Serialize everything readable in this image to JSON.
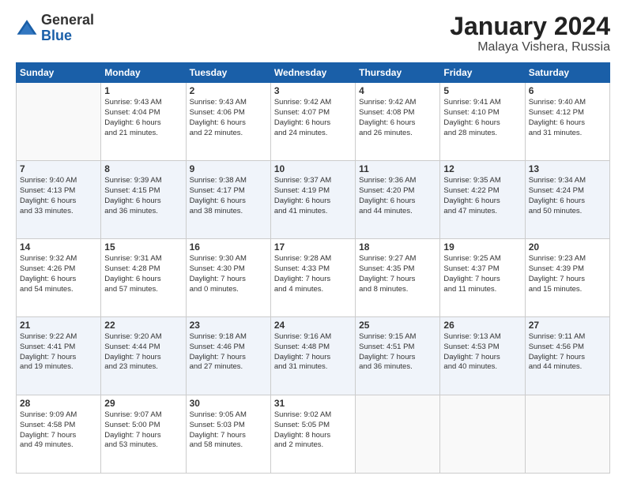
{
  "header": {
    "logo_general": "General",
    "logo_blue": "Blue",
    "title": "January 2024",
    "subtitle": "Malaya Vishera, Russia"
  },
  "calendar": {
    "headers": [
      "Sunday",
      "Monday",
      "Tuesday",
      "Wednesday",
      "Thursday",
      "Friday",
      "Saturday"
    ],
    "rows": [
      [
        {
          "day": "",
          "detail": ""
        },
        {
          "day": "1",
          "detail": "Sunrise: 9:43 AM\nSunset: 4:04 PM\nDaylight: 6 hours\nand 21 minutes."
        },
        {
          "day": "2",
          "detail": "Sunrise: 9:43 AM\nSunset: 4:06 PM\nDaylight: 6 hours\nand 22 minutes."
        },
        {
          "day": "3",
          "detail": "Sunrise: 9:42 AM\nSunset: 4:07 PM\nDaylight: 6 hours\nand 24 minutes."
        },
        {
          "day": "4",
          "detail": "Sunrise: 9:42 AM\nSunset: 4:08 PM\nDaylight: 6 hours\nand 26 minutes."
        },
        {
          "day": "5",
          "detail": "Sunrise: 9:41 AM\nSunset: 4:10 PM\nDaylight: 6 hours\nand 28 minutes."
        },
        {
          "day": "6",
          "detail": "Sunrise: 9:40 AM\nSunset: 4:12 PM\nDaylight: 6 hours\nand 31 minutes."
        }
      ],
      [
        {
          "day": "7",
          "detail": "Sunrise: 9:40 AM\nSunset: 4:13 PM\nDaylight: 6 hours\nand 33 minutes."
        },
        {
          "day": "8",
          "detail": "Sunrise: 9:39 AM\nSunset: 4:15 PM\nDaylight: 6 hours\nand 36 minutes."
        },
        {
          "day": "9",
          "detail": "Sunrise: 9:38 AM\nSunset: 4:17 PM\nDaylight: 6 hours\nand 38 minutes."
        },
        {
          "day": "10",
          "detail": "Sunrise: 9:37 AM\nSunset: 4:19 PM\nDaylight: 6 hours\nand 41 minutes."
        },
        {
          "day": "11",
          "detail": "Sunrise: 9:36 AM\nSunset: 4:20 PM\nDaylight: 6 hours\nand 44 minutes."
        },
        {
          "day": "12",
          "detail": "Sunrise: 9:35 AM\nSunset: 4:22 PM\nDaylight: 6 hours\nand 47 minutes."
        },
        {
          "day": "13",
          "detail": "Sunrise: 9:34 AM\nSunset: 4:24 PM\nDaylight: 6 hours\nand 50 minutes."
        }
      ],
      [
        {
          "day": "14",
          "detail": "Sunrise: 9:32 AM\nSunset: 4:26 PM\nDaylight: 6 hours\nand 54 minutes."
        },
        {
          "day": "15",
          "detail": "Sunrise: 9:31 AM\nSunset: 4:28 PM\nDaylight: 6 hours\nand 57 minutes."
        },
        {
          "day": "16",
          "detail": "Sunrise: 9:30 AM\nSunset: 4:30 PM\nDaylight: 7 hours\nand 0 minutes."
        },
        {
          "day": "17",
          "detail": "Sunrise: 9:28 AM\nSunset: 4:33 PM\nDaylight: 7 hours\nand 4 minutes."
        },
        {
          "day": "18",
          "detail": "Sunrise: 9:27 AM\nSunset: 4:35 PM\nDaylight: 7 hours\nand 8 minutes."
        },
        {
          "day": "19",
          "detail": "Sunrise: 9:25 AM\nSunset: 4:37 PM\nDaylight: 7 hours\nand 11 minutes."
        },
        {
          "day": "20",
          "detail": "Sunrise: 9:23 AM\nSunset: 4:39 PM\nDaylight: 7 hours\nand 15 minutes."
        }
      ],
      [
        {
          "day": "21",
          "detail": "Sunrise: 9:22 AM\nSunset: 4:41 PM\nDaylight: 7 hours\nand 19 minutes."
        },
        {
          "day": "22",
          "detail": "Sunrise: 9:20 AM\nSunset: 4:44 PM\nDaylight: 7 hours\nand 23 minutes."
        },
        {
          "day": "23",
          "detail": "Sunrise: 9:18 AM\nSunset: 4:46 PM\nDaylight: 7 hours\nand 27 minutes."
        },
        {
          "day": "24",
          "detail": "Sunrise: 9:16 AM\nSunset: 4:48 PM\nDaylight: 7 hours\nand 31 minutes."
        },
        {
          "day": "25",
          "detail": "Sunrise: 9:15 AM\nSunset: 4:51 PM\nDaylight: 7 hours\nand 36 minutes."
        },
        {
          "day": "26",
          "detail": "Sunrise: 9:13 AM\nSunset: 4:53 PM\nDaylight: 7 hours\nand 40 minutes."
        },
        {
          "day": "27",
          "detail": "Sunrise: 9:11 AM\nSunset: 4:56 PM\nDaylight: 7 hours\nand 44 minutes."
        }
      ],
      [
        {
          "day": "28",
          "detail": "Sunrise: 9:09 AM\nSunset: 4:58 PM\nDaylight: 7 hours\nand 49 minutes."
        },
        {
          "day": "29",
          "detail": "Sunrise: 9:07 AM\nSunset: 5:00 PM\nDaylight: 7 hours\nand 53 minutes."
        },
        {
          "day": "30",
          "detail": "Sunrise: 9:05 AM\nSunset: 5:03 PM\nDaylight: 7 hours\nand 58 minutes."
        },
        {
          "day": "31",
          "detail": "Sunrise: 9:02 AM\nSunset: 5:05 PM\nDaylight: 8 hours\nand 2 minutes."
        },
        {
          "day": "",
          "detail": ""
        },
        {
          "day": "",
          "detail": ""
        },
        {
          "day": "",
          "detail": ""
        }
      ]
    ]
  }
}
